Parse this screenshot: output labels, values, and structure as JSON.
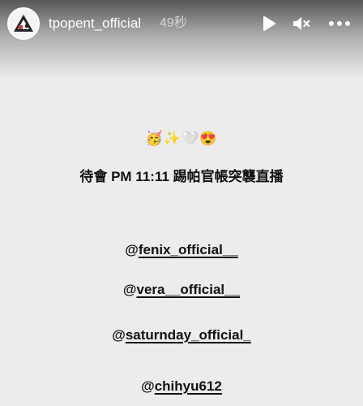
{
  "story": {
    "username": "tpopent_official",
    "time_ago": "49秒"
  },
  "controls": {
    "play_icon": "play-icon",
    "mute_icon": "speaker-muted-icon",
    "more_icon": "more-horizontal-icon"
  },
  "content": {
    "emojis": [
      "🥳",
      "✨",
      "🤍",
      "😍"
    ],
    "announcement": "待會 PM 11:11 踢帕官帳突襲直播",
    "mentions": [
      {
        "at": "@",
        "handle": "fenix_official__"
      },
      {
        "at": "@",
        "handle": "vera__official__"
      },
      {
        "at": "@",
        "handle": "saturnday_official_"
      },
      {
        "at": "@",
        "handle": "chihyu612"
      }
    ]
  },
  "colors": {
    "background": "#ececec",
    "text": "#111111",
    "header_text": "#ffffff"
  }
}
